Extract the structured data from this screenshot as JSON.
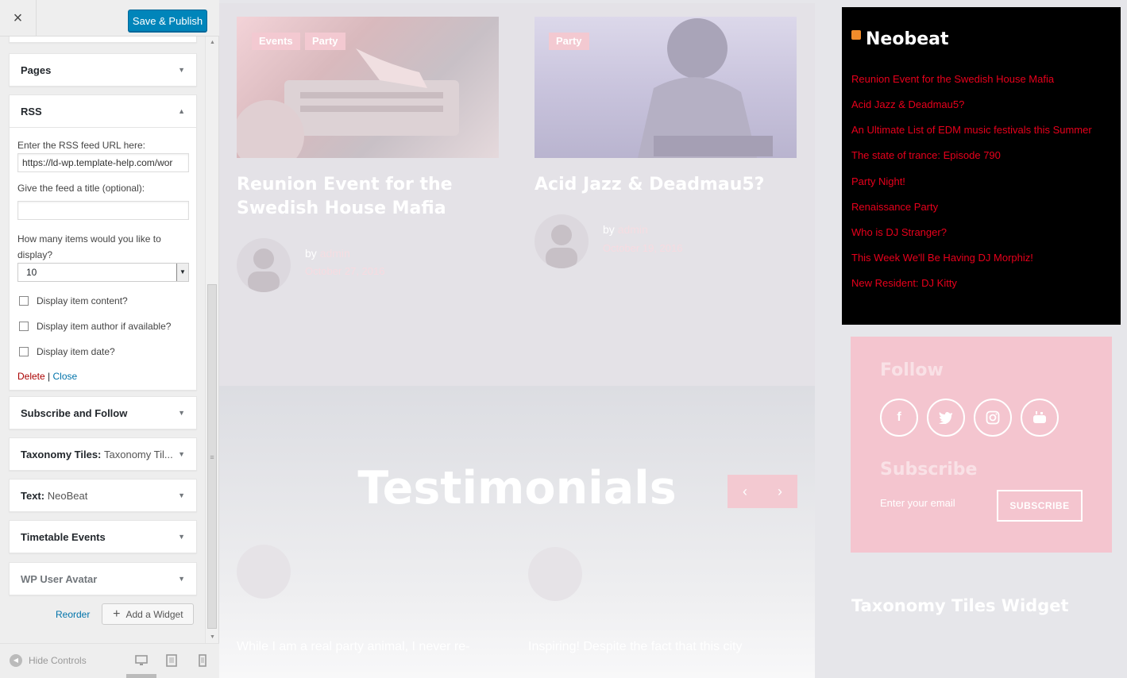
{
  "sidebar": {
    "close_glyph": "×",
    "publish_label": "Save & Publish",
    "widgets": {
      "pages": "Pages",
      "rss": "RSS",
      "subscribe": "Subscribe and Follow",
      "taxonomy": "Taxonomy Tiles:",
      "taxonomy_sub": "Taxonomy Til...",
      "text": "Text:",
      "text_sub": "NeoBeat",
      "timetable": "Timetable Events",
      "wp_user": "WP User Avatar"
    },
    "rss_form": {
      "url_label": "Enter the RSS feed URL here:",
      "url_value": "https://ld-wp.template-help.com/wor",
      "title_label": "Give the feed a title (optional):",
      "title_value": "",
      "items_label": "How many items would you like to display?",
      "items_value": "10",
      "opt_content": "Display item content?",
      "opt_author": "Display item author if available?",
      "opt_date": "Display item date?",
      "delete_label": "Delete",
      "separator": "|",
      "close_label": "Close"
    },
    "reorder_label": "Reorder",
    "add_widget_label": "Add a Widget",
    "hide_controls_label": "Hide Controls"
  },
  "preview": {
    "post1": {
      "tags": [
        "Events",
        "Party"
      ],
      "title": "Reunion Event for the Swedish House Mafia",
      "by": "by",
      "author": "admin",
      "date": "October 27, 2016"
    },
    "post2": {
      "tags": [
        "Party"
      ],
      "title": "Acid Jazz & Deadmau5?",
      "by": "by",
      "author": "admin",
      "date": "October 19, 2016"
    },
    "testimonials_title": "Testimonials",
    "prev_glyph": "‹",
    "next_glyph": "›",
    "quote1": "While I am a real party animal, I never re-",
    "quote2": "Inspiring! Despite the fact that this city",
    "rss_widget": {
      "title": "Neobeat",
      "links": [
        "Reunion Event for the Swedish House Mafia",
        "Acid Jazz & Deadmau5?",
        "An Ultimate List of EDM music festivals this Summer",
        "The state of trance: Episode 790",
        "Party Night!",
        "Renaissance Party",
        "Who is DJ Stranger?",
        "This Week We'll Be Having DJ Morphiz!",
        "New Resident: DJ Kitty"
      ]
    },
    "follow": {
      "title": "Follow",
      "socials": [
        "f",
        "t",
        "ig",
        "yt"
      ],
      "subscribe_title": "Subscribe",
      "email_placeholder": "Enter your email",
      "subscribe_button": "SUBSCRIBE"
    },
    "taxonomy_title": "Taxonomy Tiles Widget"
  },
  "colors": {
    "publish": "#0085ba",
    "link_red": "#e8001c",
    "pink": "#f4c5cf"
  }
}
